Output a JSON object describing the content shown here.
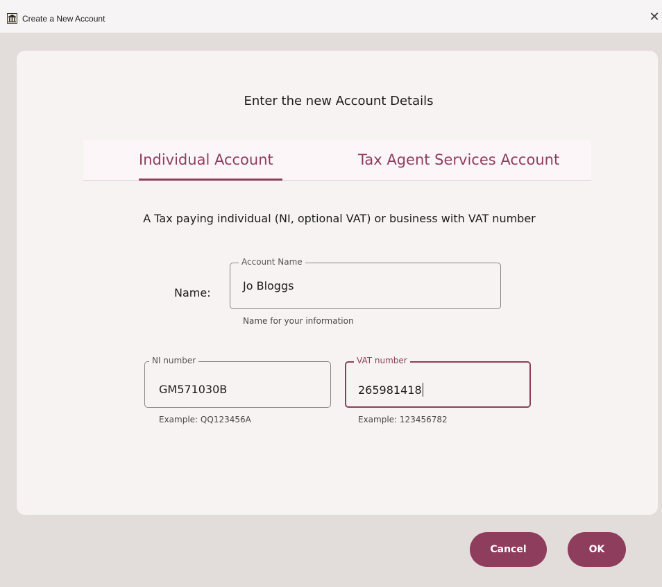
{
  "window": {
    "title": "Create a New Account",
    "icon": "building-app-icon",
    "close_glyph": "✕"
  },
  "dialog": {
    "heading": "Enter the new Account Details",
    "tabs": [
      {
        "label": "Individual Account",
        "selected": true
      },
      {
        "label": "Tax Agent Services Account",
        "selected": false
      }
    ],
    "description": "A Tax paying individual (NI, optional VAT) or business with VAT number",
    "name_label": "Name:",
    "account_name": {
      "legend": "Account Name",
      "value": "Jo Bloggs",
      "helper": "Name for your information"
    },
    "ni_number": {
      "legend": "NI number",
      "value": "GM571030B",
      "helper": "Example: QQ123456A"
    },
    "vat_number": {
      "legend": "VAT number",
      "value": "265981418",
      "helper": "Example: 123456782",
      "focused": true
    }
  },
  "buttons": {
    "cancel": "Cancel",
    "ok": "OK"
  },
  "colors": {
    "accent": "#8f3d5d",
    "window_bg": "#e2dcdb",
    "card_bg": "#f7f3f2",
    "tabbar_bg": "#fdf6f9"
  }
}
